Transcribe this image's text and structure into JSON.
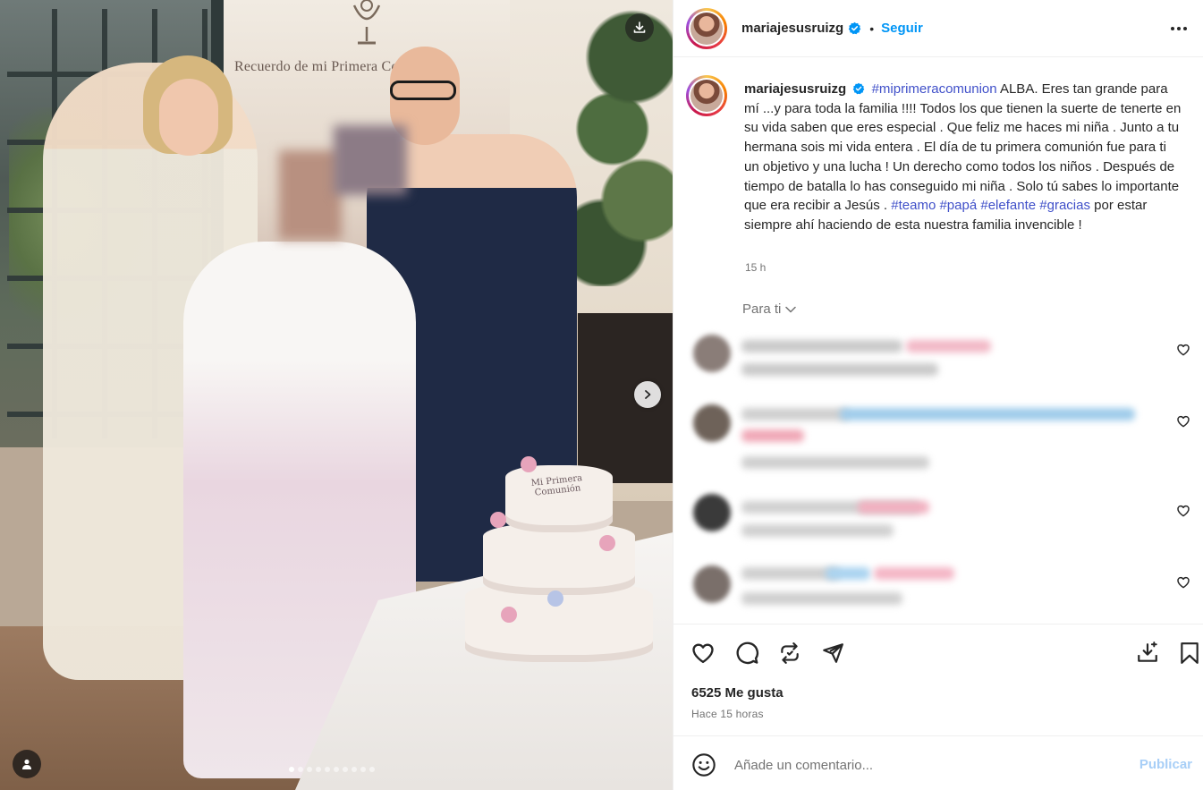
{
  "media": {
    "banner_text": "Recuerdo de mi Primera Comunión",
    "cake_text": "Mi Primera Comunión",
    "carousel": {
      "total": 10,
      "active_index": 0
    },
    "icons": {
      "download": "download-icon",
      "next": "chevron-right-icon",
      "tag": "person-tag-icon"
    }
  },
  "header": {
    "username": "mariajesusruizg",
    "follow_label": "Seguir",
    "separator": "•",
    "more_icon": "more-horizontal-icon"
  },
  "caption": {
    "username": "mariajesusruizg",
    "segments": [
      {
        "type": "tag",
        "text": "#miprimeracomunion"
      },
      {
        "type": "text",
        "text": " ALBA. Eres tan grande para mí ...y para toda la familia !!!! Todos los que tienen la suerte de tenerte en su vida saben que eres especial . Que feliz me haces mi niña . Junto a tu hermana sois mi vida entera . El día de tu primera comunión fue para ti un objetivo y una lucha ! Un derecho como todos los niños . Después de tiempo de batalla lo has conseguido mi niña . Solo tú sabes lo importante que era recibir a Jesús . "
      },
      {
        "type": "tag",
        "text": "#teamo"
      },
      {
        "type": "text",
        "text": " "
      },
      {
        "type": "tag",
        "text": "#papá"
      },
      {
        "type": "text",
        "text": " "
      },
      {
        "type": "tag",
        "text": "#elefante"
      },
      {
        "type": "text",
        "text": " "
      },
      {
        "type": "tag",
        "text": "#gracias"
      },
      {
        "type": "text",
        "text": " por estar siempre ahí haciendo de esta nuestra familia invencible !"
      }
    ],
    "time": "15 h"
  },
  "comments_section": {
    "filter_label": "Para ti",
    "comments": [
      {
        "avatar_color": "#8a7d78",
        "line_colors": [
          "#c9c9c9",
          "#f2b8c6"
        ],
        "has_heart": true
      },
      {
        "avatar_color": "#6e6259",
        "line_colors": [
          "#cfcfcf",
          "#9ecbea",
          "#f0a7b6"
        ],
        "has_heart": true
      },
      {
        "avatar_color": "#3a3a3a",
        "line_colors": [
          "#d0d0d0",
          "#f2b0c0"
        ],
        "has_heart": true
      },
      {
        "avatar_color": "#7a6f6a",
        "line_colors": [
          "#cfcfcf",
          "#a9d3f0",
          "#f4b5c5"
        ],
        "has_heart": true
      }
    ]
  },
  "actions": {
    "icons": {
      "like": "heart-icon",
      "comment": "comment-bubble-icon",
      "repost": "repost-icon",
      "share": "send-icon",
      "download": "download-tray-icon",
      "save": "bookmark-icon"
    },
    "likes_label": "6525 Me gusta",
    "time_ago": "Hace 15 horas"
  },
  "comment_box": {
    "placeholder": "Añade un comentario...",
    "publish_label": "Publicar",
    "emoji_icon": "emoji-smile-icon"
  },
  "colors": {
    "link": "#0095f6",
    "hashtag": "#4050c9",
    "muted": "#737373",
    "text": "#262626"
  }
}
